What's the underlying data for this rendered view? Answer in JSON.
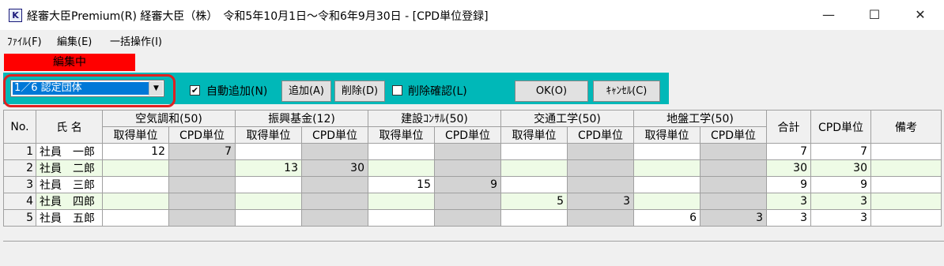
{
  "window": {
    "title": "経審大臣Premium(R) 経審大臣（株）　令和5年10月1日～令和6年9月30日 - [CPD単位登録]",
    "app_icon": "K",
    "minimize": "—",
    "maximize": "☐",
    "close": "✕"
  },
  "menu": [
    "ﾌｧｲﾙ(F)",
    "編集(E)",
    "一括操作(I)"
  ],
  "status_badge": "編集中",
  "toolbar": {
    "group_select": "1／6 認定団体",
    "auto_add_label": "自動追加(N)",
    "auto_add_checked": "✔",
    "add_button": "追加(A)",
    "delete_button": "削除(D)",
    "delete_confirm_label": "削除確認(L)",
    "ok_button": "OK(O)",
    "cancel_button": "ｷｬﾝｾﾙ(C)"
  },
  "table": {
    "no_header": "No.",
    "name_header": "氏 名",
    "groups": [
      "空気調和(50)",
      "振興基金(12)",
      "建設ｺﾝｻﾙ(50)",
      "交通工学(50)",
      "地盤工学(50)"
    ],
    "sub_earned": "取得単位",
    "sub_cpd": "CPD単位",
    "total_header": "合計",
    "cpd_header": "CPD単位",
    "notes_header": "備考",
    "rows": [
      {
        "no": "1",
        "name": "社員　一郎",
        "cells": [
          "12",
          "7",
          "",
          "",
          "",
          "",
          "",
          "",
          "",
          ""
        ],
        "total": "7",
        "cpd": "7",
        "notes": ""
      },
      {
        "no": "2",
        "name": "社員　二郎",
        "cells": [
          "",
          "",
          "13",
          "30",
          "",
          "",
          "",
          "",
          "",
          ""
        ],
        "total": "30",
        "cpd": "30",
        "notes": ""
      },
      {
        "no": "3",
        "name": "社員　三郎",
        "cells": [
          "",
          "",
          "",
          "",
          "15",
          "9",
          "",
          "",
          "",
          ""
        ],
        "total": "9",
        "cpd": "9",
        "notes": ""
      },
      {
        "no": "4",
        "name": "社員　四郎",
        "cells": [
          "",
          "",
          "",
          "",
          "",
          "",
          "5",
          "3",
          "",
          ""
        ],
        "total": "3",
        "cpd": "3",
        "notes": ""
      },
      {
        "no": "5",
        "name": "社員　五郎",
        "cells": [
          "",
          "",
          "",
          "",
          "",
          "",
          "",
          "",
          "6",
          "3"
        ],
        "total": "3",
        "cpd": "3",
        "notes": ""
      }
    ]
  }
}
